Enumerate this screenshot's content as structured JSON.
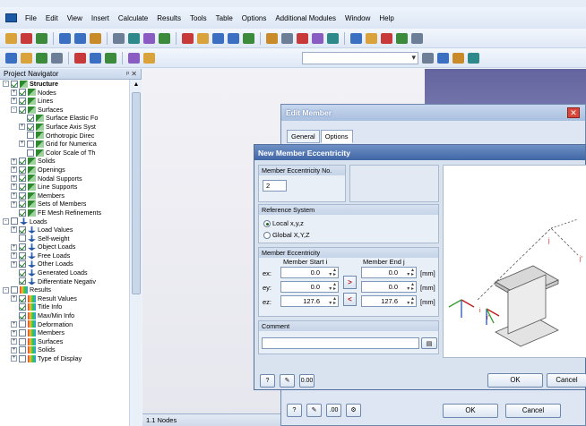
{
  "menu": [
    "File",
    "Edit",
    "View",
    "Insert",
    "Calculate",
    "Results",
    "Tools",
    "Table",
    "Options",
    "Additional Modules",
    "Window",
    "Help"
  ],
  "navigator": {
    "title": "Project Navigator",
    "controls": "ᵖ ✕",
    "tree": [
      {
        "level": 0,
        "expand": "-",
        "check": "on",
        "icon": "struct",
        "label": "Structure",
        "bold": true
      },
      {
        "level": 1,
        "expand": "+",
        "check": "on",
        "icon": "struct",
        "label": "Nodes"
      },
      {
        "level": 1,
        "expand": "+",
        "check": "on",
        "icon": "struct",
        "label": "Lines"
      },
      {
        "level": 1,
        "expand": "-",
        "check": "on",
        "icon": "struct",
        "label": "Surfaces"
      },
      {
        "level": 2,
        "expand": "",
        "check": "on",
        "icon": "struct",
        "label": "Surface Elastic Fo"
      },
      {
        "level": 2,
        "expand": "+",
        "check": "on",
        "icon": "struct",
        "label": "Surface Axis Syst"
      },
      {
        "level": 2,
        "expand": "",
        "check": "off",
        "icon": "struct",
        "label": "Orthotropic Direc"
      },
      {
        "level": 2,
        "expand": "+",
        "check": "off",
        "icon": "struct",
        "label": "Grid for Numerica"
      },
      {
        "level": 2,
        "expand": "",
        "check": "off",
        "icon": "struct",
        "label": "Color Scale of Th"
      },
      {
        "level": 1,
        "expand": "+",
        "check": "on",
        "icon": "struct",
        "label": "Solids"
      },
      {
        "level": 1,
        "expand": "+",
        "check": "on",
        "icon": "struct",
        "label": "Openings"
      },
      {
        "level": 1,
        "expand": "+",
        "check": "on",
        "icon": "struct",
        "label": "Nodal Supports"
      },
      {
        "level": 1,
        "expand": "+",
        "check": "on",
        "icon": "struct",
        "label": "Line Supports"
      },
      {
        "level": 1,
        "expand": "+",
        "check": "on",
        "icon": "struct",
        "label": "Members"
      },
      {
        "level": 1,
        "expand": "+",
        "check": "on",
        "icon": "struct",
        "label": "Sets of Members"
      },
      {
        "level": 1,
        "expand": "",
        "check": "on",
        "icon": "struct",
        "label": "FE Mesh Refinements"
      },
      {
        "level": 0,
        "expand": "-",
        "check": "off",
        "icon": "load",
        "label": "Loads"
      },
      {
        "level": 1,
        "expand": "+",
        "check": "on",
        "icon": "load",
        "label": "Load Values"
      },
      {
        "level": 1,
        "expand": "",
        "check": "off",
        "icon": "load",
        "label": "Self-weight"
      },
      {
        "level": 1,
        "expand": "+",
        "check": "on",
        "icon": "load",
        "label": "Object Loads"
      },
      {
        "level": 1,
        "expand": "+",
        "check": "on",
        "icon": "load",
        "label": "Free Loads"
      },
      {
        "level": 1,
        "expand": "+",
        "check": "on",
        "icon": "load",
        "label": "Other Loads"
      },
      {
        "level": 1,
        "expand": "",
        "check": "on",
        "icon": "load",
        "label": "Generated Loads"
      },
      {
        "level": 1,
        "expand": "",
        "check": "on",
        "icon": "load",
        "label": "Differentiate Negativ"
      },
      {
        "level": 0,
        "expand": "-",
        "check": "off",
        "icon": "res",
        "label": "Results"
      },
      {
        "level": 1,
        "expand": "+",
        "check": "on",
        "icon": "res",
        "label": "Result Values"
      },
      {
        "level": 1,
        "expand": "",
        "check": "on",
        "icon": "res",
        "label": "Title Info"
      },
      {
        "level": 1,
        "expand": "",
        "check": "on",
        "icon": "res",
        "label": "Max/Min Info"
      },
      {
        "level": 1,
        "expand": "+",
        "check": "off",
        "icon": "res",
        "label": "Deformation"
      },
      {
        "level": 1,
        "expand": "+",
        "check": "off",
        "icon": "res",
        "label": "Members"
      },
      {
        "level": 1,
        "expand": "+",
        "check": "off",
        "icon": "res",
        "label": "Surfaces"
      },
      {
        "level": 1,
        "expand": "+",
        "check": "off",
        "icon": "res",
        "label": "Solids"
      },
      {
        "level": 1,
        "expand": "+",
        "check": "off",
        "icon": "res",
        "label": "Type of Display"
      }
    ]
  },
  "statusbar": {
    "tab": "1.1 Nodes"
  },
  "edit_member": {
    "title": "Edit Member",
    "tabs": [
      "General",
      "Options"
    ],
    "ok": "OK",
    "cancel": "Cancel"
  },
  "ecc_dialog": {
    "title": "New Member Eccentricity",
    "no_group": "Member Eccentricity No.",
    "no_value": "2",
    "ref_group": "Reference System",
    "ref_local": "Local x,y,z",
    "ref_global": "Global X,Y,Z",
    "ecc_group": "Member Eccentricity",
    "col_start": "Member Start i",
    "col_end": "Member End j",
    "rows": [
      {
        "label": "ex:",
        "start": "0.0",
        "end": "0.0",
        "unit": "[mm]"
      },
      {
        "label": "ey:",
        "start": "0.0",
        "end": "0.0",
        "unit": "[mm]"
      },
      {
        "label": "ez:",
        "start": "127.6",
        "end": "127.6",
        "unit": "[mm]"
      }
    ],
    "comment_group": "Comment",
    "comment_value": "",
    "ok": "OK",
    "cancel": "Cancel",
    "footer_icons": [
      "help-icon",
      "edit-icon",
      "decimal-icon"
    ],
    "footer_labels": [
      "?",
      "✎",
      "0.00"
    ]
  }
}
